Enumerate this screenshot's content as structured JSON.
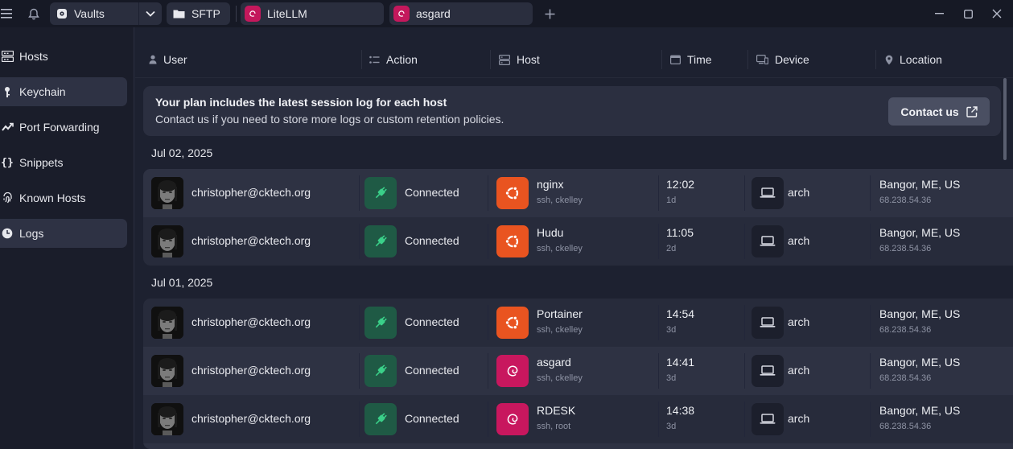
{
  "topbar": {
    "vaults_label": "Vaults",
    "tabs": [
      {
        "label": "SFTP"
      },
      {
        "label": "LiteLLM"
      },
      {
        "label": "asgard"
      }
    ]
  },
  "sidebar": {
    "items": [
      {
        "label": "Hosts",
        "icon": "hosts-icon"
      },
      {
        "label": "Keychain",
        "icon": "key-icon"
      },
      {
        "label": "Port Forwarding",
        "icon": "port-forward-icon"
      },
      {
        "label": "Snippets",
        "icon": "braces-icon"
      },
      {
        "label": "Known Hosts",
        "icon": "fingerprint-icon"
      },
      {
        "label": "Logs",
        "icon": "clock-icon"
      }
    ]
  },
  "columns": {
    "user": "User",
    "action": "Action",
    "host": "Host",
    "time": "Time",
    "device": "Device",
    "location": "Location"
  },
  "banner": {
    "title": "Your plan includes the latest session log for each host",
    "text": "Contact us if you need to store more logs or custom retention policies.",
    "button": "Contact us"
  },
  "groups": [
    {
      "date": "Jul 02, 2025",
      "rows": [
        {
          "user": "christopher@cktech.org",
          "action": "Connected",
          "host": "nginx",
          "host_sub": "ssh, ckelley",
          "host_os": "ubuntu",
          "time": "12:02",
          "ago": "1d",
          "device": "arch",
          "location": "Bangor, ME, US",
          "ip": "68.238.54.36"
        },
        {
          "user": "christopher@cktech.org",
          "action": "Connected",
          "host": "Hudu",
          "host_sub": "ssh, ckelley",
          "host_os": "ubuntu",
          "time": "11:05",
          "ago": "2d",
          "device": "arch",
          "location": "Bangor, ME, US",
          "ip": "68.238.54.36"
        }
      ]
    },
    {
      "date": "Jul 01, 2025",
      "rows": [
        {
          "user": "christopher@cktech.org",
          "action": "Connected",
          "host": "Portainer",
          "host_sub": "ssh, ckelley",
          "host_os": "ubuntu",
          "time": "14:54",
          "ago": "3d",
          "device": "arch",
          "location": "Bangor, ME, US",
          "ip": "68.238.54.36"
        },
        {
          "user": "christopher@cktech.org",
          "action": "Connected",
          "host": "asgard",
          "host_sub": "ssh, ckelley",
          "host_os": "debian",
          "time": "14:41",
          "ago": "3d",
          "device": "arch",
          "location": "Bangor, ME, US",
          "ip": "68.238.54.36"
        },
        {
          "user": "christopher@cktech.org",
          "action": "Connected",
          "host": "RDESK",
          "host_sub": "ssh, root",
          "host_os": "debian",
          "time": "14:38",
          "ago": "3d",
          "device": "arch",
          "location": "Bangor, ME, US",
          "ip": "68.238.54.36"
        }
      ]
    }
  ],
  "colors": {
    "ubuntu": "#e95420",
    "debian": "#c8175e",
    "connected": "#1f5a45",
    "connected_icon": "#3ad089"
  }
}
